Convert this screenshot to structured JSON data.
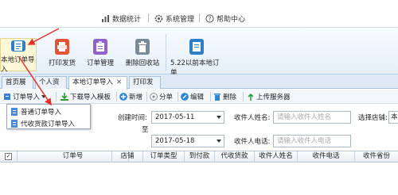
{
  "topbar": {
    "links": [
      {
        "label": "数据统计",
        "icon": "chart-icon"
      },
      {
        "label": "系统管理",
        "icon": "gear-icon"
      },
      {
        "label": "帮助中心",
        "icon": "help-icon"
      }
    ]
  },
  "ribbon": {
    "buttons": [
      {
        "label": "本地订单导入",
        "icon": "import-doc-icon"
      },
      {
        "label": "打印发货",
        "icon": "printer-icon"
      },
      {
        "label": "订单管理",
        "icon": "order-manage-icon"
      },
      {
        "label": "删除回收站",
        "icon": "trash-icon"
      },
      {
        "label": "5.22以前本地订单",
        "icon": "legacy-order-icon"
      }
    ]
  },
  "tabs": [
    {
      "label": "首页展示"
    },
    {
      "label": "个人资料"
    },
    {
      "label": "本地订单导入",
      "close": "✕"
    },
    {
      "label": "打印发货"
    }
  ],
  "toolbar": {
    "order_import": "订单导入",
    "download_template": "下载导入模板",
    "new": "新增",
    "split": "分单",
    "edit": "编辑",
    "delete": "删除",
    "upload": "上传服务器"
  },
  "dropdown_menu": {
    "items": [
      "普通订单导入",
      "代收货款订单导入"
    ]
  },
  "form": {
    "created_time_label": "创建时间:",
    "date_from": "2017-05-11",
    "to_label": "至",
    "date_to": "2017-05-18",
    "receiver_name_label": "收件人姓名:",
    "receiver_name_placeholder": "请输入收件人姓名",
    "receiver_phone_label": "收件人电话:",
    "receiver_phone_placeholder": "请输入收件人电话",
    "shop_label": "选择店铺:",
    "shop_value": "本"
  },
  "grid": {
    "select_all": "✓",
    "columns": [
      "订单号",
      "店铺",
      "订单类型",
      "到付款",
      "代收货款",
      "收件人姓名",
      "收件电话",
      "收件省份"
    ]
  },
  "colors": {
    "accent_arrow": "#e5322d",
    "ribbon_selected": "#fff8d8"
  }
}
